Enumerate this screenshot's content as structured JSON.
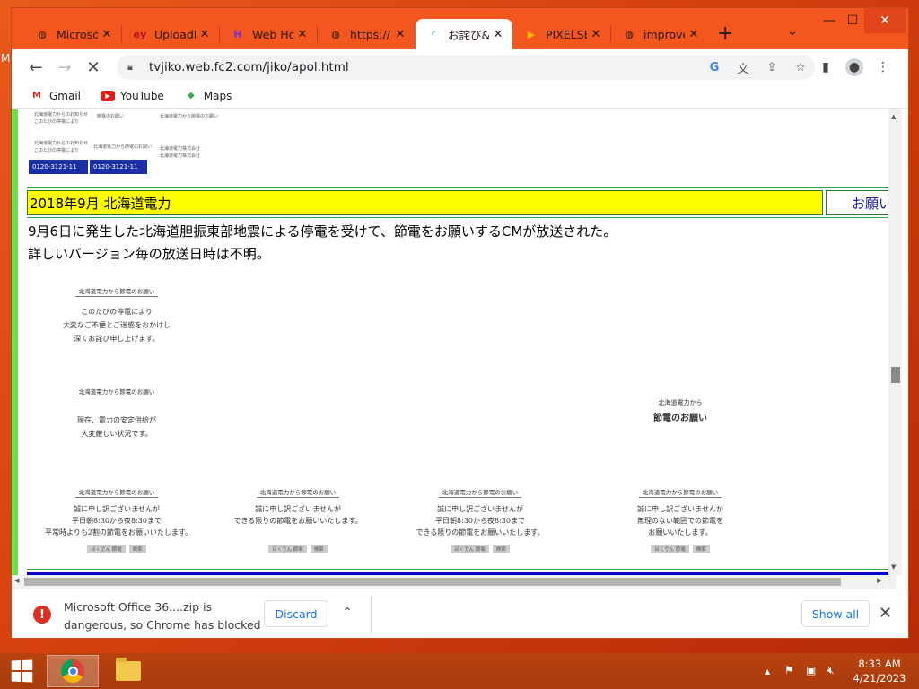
{
  "desktop": {
    "stray_text": "M"
  },
  "browser": {
    "tabs": [
      {
        "title": "Microsoft",
        "icon": "globe-icon",
        "active": false
      },
      {
        "title": "UploadE",
        "icon": "upload-icon",
        "active": false
      },
      {
        "title": "Web Ho",
        "icon": "webhost-icon",
        "active": false
      },
      {
        "title": "https://",
        "icon": "globe-icon",
        "active": false
      },
      {
        "title": "お詫び&",
        "icon": "loading-icon",
        "active": true
      },
      {
        "title": "PIXELSE",
        "icon": "pixelse-icon",
        "active": false
      },
      {
        "title": "improve",
        "icon": "globe-icon",
        "active": false
      }
    ],
    "new_tab": "+",
    "url": "tvjiko.web.fc2.com/jiko/apol.html",
    "bookmarks": [
      {
        "label": "Gmail",
        "icon": "gmail-icon"
      },
      {
        "label": "YouTube",
        "icon": "youtube-icon"
      },
      {
        "label": "Maps",
        "icon": "maps-icon"
      }
    ]
  },
  "page": {
    "top_scan": {
      "lines": [
        "北海道電力からのお知らせ",
        "このたびの停電により",
        "節電のお願い",
        "北海道電力から節電のお願い",
        "北海道電力株式会社"
      ],
      "phone_1": "0120-3121-11",
      "phone_2": "0120-3121-11"
    },
    "section_header": "2018年9月 北海道電力",
    "section_link": "お願い",
    "description_line1": "9月6日に発生した北海道胆振東部地震による停電を受けて、節電をお願いするCMが放送された。",
    "description_line2": "詳しいバージョン毎の放送日時は不明。",
    "captions": {
      "cap1": {
        "title": "北海道電力から節電のお願い",
        "lines": [
          "このたびの停電により",
          "大変なご不便とご迷惑をおかけし",
          "深くお詫び申し上げます。"
        ]
      },
      "cap2": {
        "title": "北海道電力から節電のお願い",
        "lines": [
          "現在、電力の安定供給が",
          "大変厳しい状況です。"
        ]
      },
      "cap3": {
        "small": "北海道電力から",
        "big": "節電のお願い"
      },
      "cap4": {
        "title": "北海道電力から節電のお願い",
        "lines": [
          "誠に申し訳ございませんが",
          "平日朝8:30から夜8:30まで",
          "平常時よりも2割の節電をお願いいたします。"
        ],
        "search": "ほくでん 節電",
        "btn": "検索"
      },
      "cap5": {
        "title": "北海道電力から節電のお願い",
        "lines": [
          "誠に申し訳ございませんが",
          "できる限りの節電をお願いいたします。"
        ],
        "search": "ほくでん 節電",
        "btn": "検索"
      },
      "cap6": {
        "title": "北海道電力から節電のお願い",
        "lines": [
          "誠に申し訳ございませんが",
          "平日朝8:30から夜8:30まで",
          "できる限りの節電をお願いいたします。"
        ],
        "search": "ほくでん 節電",
        "btn": "検索"
      },
      "cap7": {
        "title": "北海道電力から節電のお願い",
        "lines": [
          "誠に申し訳ございませんが",
          "無理のない範囲での節電を",
          "お願いいたします。"
        ],
        "search": "ほくでん 節電",
        "btn": "検索"
      }
    }
  },
  "download_bar": {
    "message_line1": "Microsoft Office 36....zip is",
    "message_line2": "dangerous, so Chrome has blocked it.",
    "discard": "Discard",
    "show_all": "Show all"
  },
  "taskbar": {
    "time": "8:33 AM",
    "date": "4/21/2023"
  },
  "colors": {
    "desktop": "#d7420f",
    "tabstrip": "#f3561f",
    "section_header_bg": "#ffff00",
    "left_bar": "#66e14a",
    "bottom_bar": "#0000c8"
  }
}
